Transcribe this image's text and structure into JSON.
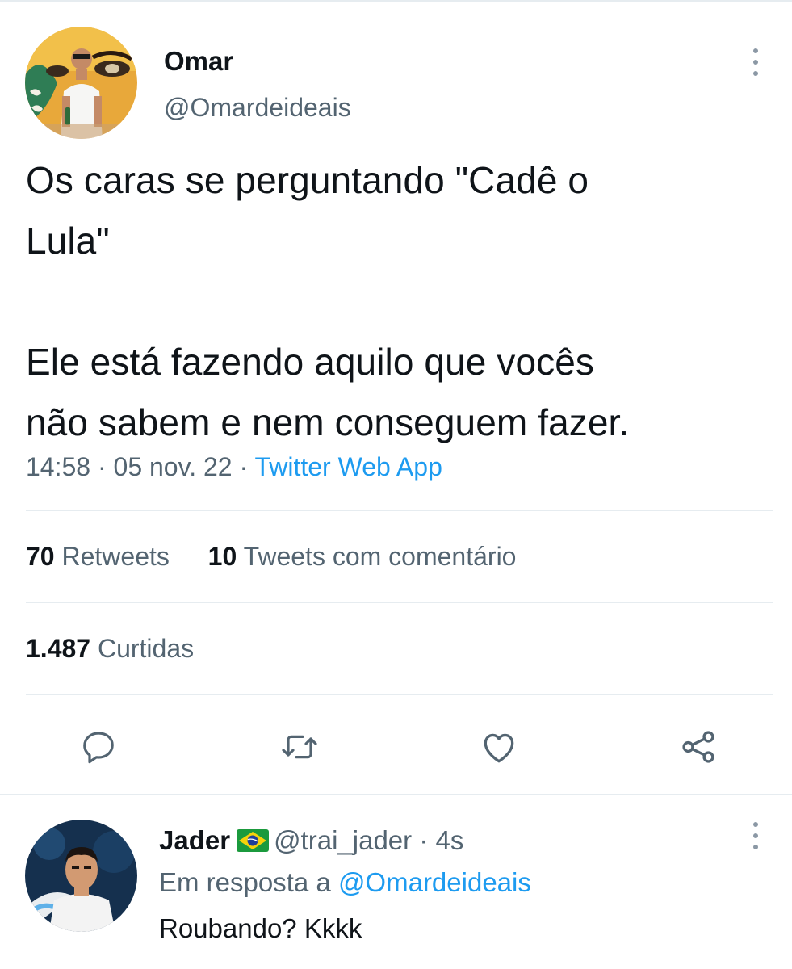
{
  "tweet": {
    "author_name": "Omar",
    "author_handle": "@Omardeideais",
    "text": "Os caras se perguntando \"Cadê o\nLula\"\n\nEle está fazendo aquilo que vocês\nnão sabem e nem conseguem fazer.",
    "time": "14:58",
    "date": "05 nov. 22",
    "separator": " · ",
    "source": "Twitter Web App"
  },
  "stats": {
    "retweets_count": "70",
    "retweets_label": "Retweets",
    "quotes_count": "10",
    "quotes_label": "Tweets com comentário",
    "likes_count": "1.487",
    "likes_label": "Curtidas"
  },
  "actions": [
    {
      "name": "reply-icon"
    },
    {
      "name": "retweet-icon"
    },
    {
      "name": "like-icon"
    },
    {
      "name": "share-icon"
    }
  ],
  "reply": {
    "author_name": "Jader",
    "flag": "brazil-flag-icon",
    "author_handle": "@trai_jader",
    "separator": " · ",
    "time": "4s",
    "replying_to_label": "Em resposta a ",
    "replying_to_handle": "@Omardeideais",
    "text": "Roubando? Kkkk"
  },
  "colors": {
    "primary_text": "#0f1419",
    "secondary_text": "#536471",
    "accent": "#1d9bf0",
    "divider": "#e6ecf0"
  }
}
